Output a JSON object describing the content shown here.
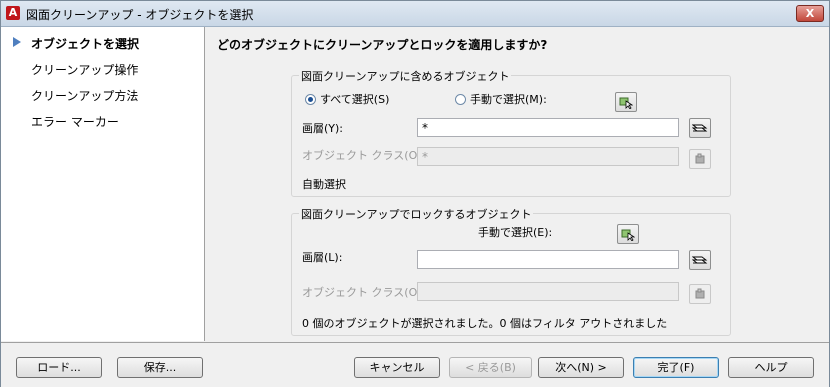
{
  "window": {
    "title": "図面クリーンアップ - オブジェクトを選択",
    "close_label": "X",
    "app_icon_letter": "A"
  },
  "sidebar": {
    "items": [
      {
        "label": "オブジェクトを選択",
        "active": true
      },
      {
        "label": "クリーンアップ操作",
        "active": false
      },
      {
        "label": "クリーンアップ方法",
        "active": false
      },
      {
        "label": "エラー マーカー",
        "active": false
      }
    ]
  },
  "main": {
    "question": "どのオブジェクトにクリーンアップとロックを適用しますか?",
    "include_group": {
      "title": "図面クリーンアップに含めるオブジェクト",
      "radio_all": "すべて選択(S)",
      "radio_manual": "手動で選択(M):",
      "layer_label": "画層(Y):",
      "layer_value": "*",
      "object_class_label": "オブジェクト クラス(O):",
      "object_class_value": "*",
      "auto_select_label": "自動選択"
    },
    "lock_group": {
      "title": "図面クリーンアップでロックするオブジェクト",
      "manual_label": "手動で選択(E):",
      "layer_label": "画層(L):",
      "layer_value": "",
      "object_class_label": "オブジェクト クラス(O):",
      "object_class_value": "",
      "status": "0 個のオブジェクトが選択されました。0 個はフィルタ アウトされました"
    }
  },
  "footer": {
    "load": "ロード...",
    "save": "保存...",
    "cancel": "キャンセル",
    "back": "< 戻る(B)",
    "next": "次へ(N) >",
    "finish": "完了(F)",
    "help": "ヘルプ"
  }
}
